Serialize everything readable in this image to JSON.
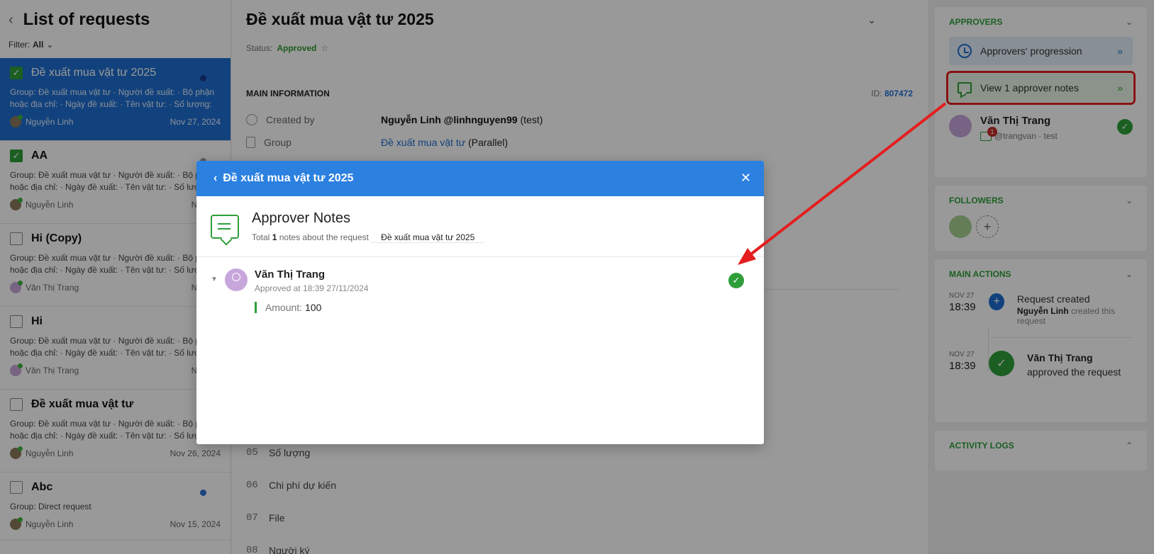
{
  "left": {
    "back_icon": "chevron-left-icon",
    "title": "List of requests",
    "filter_label": "Filter:",
    "filter_value": "All",
    "items": [
      {
        "title": "Đề xuất mua vật tư 2025",
        "checked": true,
        "active": true,
        "desc": "Group: Đề xuất mua vật tư · Người đề xuất: · Bộ phận hoặc địa chỉ: · Ngày đề xuất: · Tên vật tư: · Số lượng: ·...",
        "user": "Nguyễn Linh",
        "date": "Nov 27, 2024"
      },
      {
        "title": "AA",
        "checked": true,
        "active": false,
        "desc": "Group: Đề xuất mua vật tư · Người đề xuất: · Bộ phận hoặc địa chỉ: · Ngày đề xuất: · Tên vật tư: · Số lượng:",
        "user": "Nguyễn Linh",
        "date": "Nov 27,"
      },
      {
        "title": "Hi (Copy)",
        "checked": false,
        "active": false,
        "desc": "Group: Đề xuất mua vật tư · Người đề xuất: · Bộ phận hoặc địa chỉ: · Ngày đề xuất: · Tên vật tư: · Số lượng:",
        "user": "Văn Thị Trang",
        "date": "Nov 27,"
      },
      {
        "title": "Hi",
        "checked": false,
        "active": false,
        "desc": "Group: Đề xuất mua vật tư · Người đề xuất: · Bộ phận hoặc địa chỉ: · Ngày đề xuất: · Tên vật tư: · Số lượng:",
        "user": "Văn Thị Trang",
        "date": "Nov 27,"
      },
      {
        "title": "Đề xuất mua vật tư",
        "checked": false,
        "active": false,
        "desc": "Group: Đề xuất mua vật tư · Người đề xuất: · Bộ phận hoặc địa chỉ: · Ngày đề xuất: · Tên vật tư: · Số lượng:",
        "user": "Nguyễn Linh",
        "date": "Nov 26, 2024"
      },
      {
        "title": "Abc",
        "checked": false,
        "active": false,
        "desc": "Group: Direct request",
        "user": "Nguyễn Linh",
        "date": "Nov 15, 2024"
      }
    ]
  },
  "middle": {
    "title": "Đề xuất mua vật tư 2025",
    "status_label": "Status:",
    "status_value": "Approved",
    "main_info_label": "MAIN INFORMATION",
    "id_label": "ID:",
    "id_value": "807472",
    "created_by_label": "Created by",
    "created_by_name": "Nguyễn Linh @linhnguyen99",
    "created_by_extra": "(test)",
    "group_label": "Group",
    "group_value": "Đề xuất mua vật tư",
    "group_extra": "(Parallel)",
    "fields": [
      {
        "num": "05",
        "label": "Số lượng"
      },
      {
        "num": "06",
        "label": "Chi phí dự kiến"
      },
      {
        "num": "07",
        "label": "File"
      },
      {
        "num": "08",
        "label": "Người ký"
      }
    ]
  },
  "right": {
    "approvers_title": "APPROVERS",
    "progression_label": "Approvers' progression",
    "view_notes_label": "View 1 approver notes",
    "approver_name": "Văn Thị Trang",
    "approver_handle": "@trangvan · test",
    "approver_badge": "1",
    "followers_title": "FOLLOWERS",
    "main_actions_title": "MAIN ACTIONS",
    "actions": [
      {
        "date": "NOV 27",
        "time": "18:39",
        "title": "Request created",
        "actor": "Nguyễn Linh",
        "detail": "created this request"
      },
      {
        "date": "NOV 27",
        "time": "18:39",
        "title": "Văn Thị Trang",
        "detail": "approved the request"
      }
    ],
    "activity_logs_title": "ACTIVITY LOGS"
  },
  "modal": {
    "title": "Đề xuất mua vật tư 2025",
    "notes_title": "Approver Notes",
    "total_prefix": "Total",
    "total_count": "1",
    "total_mid": "notes about the request",
    "total_request": "Đề xuất mua vật tư 2025",
    "note": {
      "name": "Văn Thị Trang",
      "meta": "Approved at 18:39 27/11/2024",
      "field_label": "Amount:",
      "field_value": "100"
    }
  },
  "colors": {
    "accent_blue": "#2b80e0",
    "success_green": "#2e9e3a",
    "highlight_red": "#e41e1e"
  }
}
